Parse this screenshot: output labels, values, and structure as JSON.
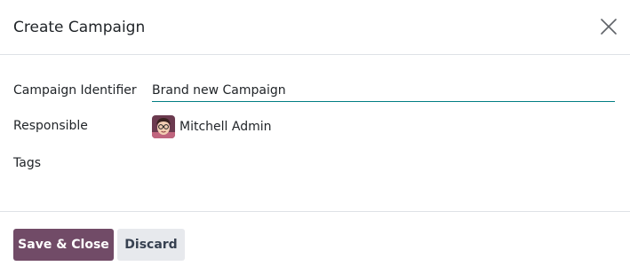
{
  "dialog": {
    "title": "Create Campaign"
  },
  "form": {
    "campaign_identifier": {
      "label": "Campaign Identifier",
      "value": "Brand new Campaign"
    },
    "responsible": {
      "label": "Responsible",
      "value": "Mitchell Admin"
    },
    "tags": {
      "label": "Tags",
      "value": ""
    }
  },
  "footer": {
    "save_label": "Save & Close",
    "discard_label": "Discard"
  },
  "colors": {
    "primary": "#714b67",
    "input_underline": "#017e84",
    "secondary_button": "#e7e9ed"
  },
  "icons": {
    "close": "close-icon",
    "avatar": "user-avatar"
  }
}
